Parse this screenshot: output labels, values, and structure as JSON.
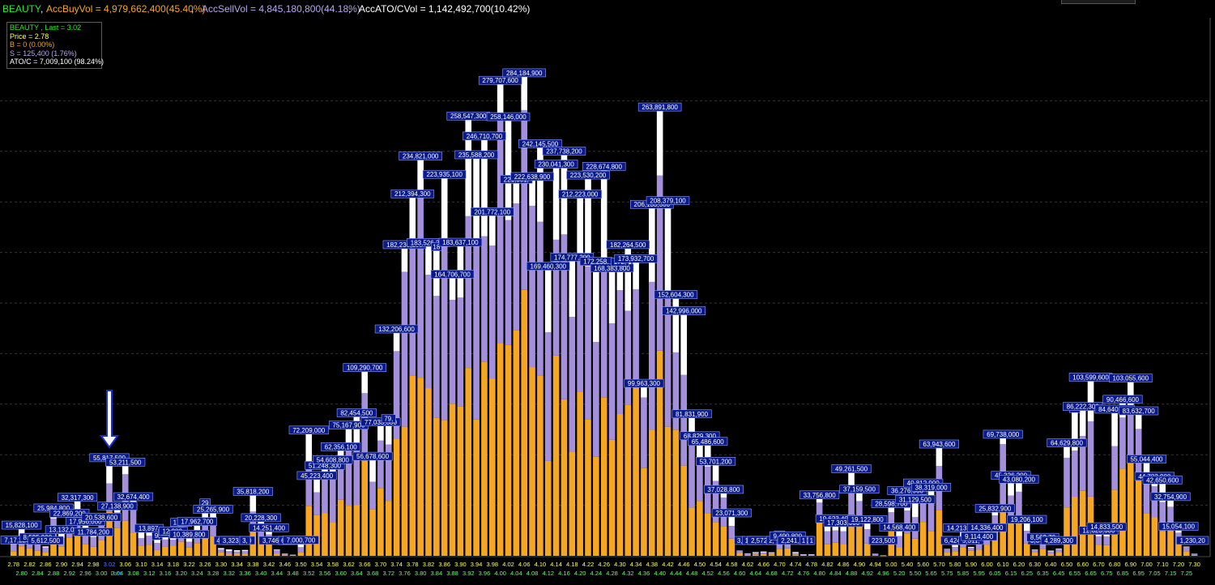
{
  "header": {
    "symbol": "BEAUTY",
    "buy_text": "AccBuyVol = 4,979,662,400(45.40%)",
    "sell_text": "AccSellVol = 4,845,180,800(44.18%)",
    "ato_text": "AccATO/CVol = 1,142,492,700(10.42%)",
    "separator": ","
  },
  "legend": {
    "title": "BEAUTY , Last = 3.02",
    "price": "Price = 2.78",
    "buy": "B = 0 (0.00%)",
    "sell": "S = 125,400 (1.76%)",
    "atoc": "ATO/C = 7,009,100 (98.24%)"
  },
  "colors": {
    "buy": "#f5a623",
    "sell": "#a48fdc",
    "atoc": "#ffffff",
    "label_bg": "#0a1a8c",
    "axis_text": "#ffff66",
    "axis_text_alt": "#66ff66",
    "current_price": "#4a7cff",
    "arrow": "#1f2fd8"
  },
  "chart_data": {
    "type": "bar",
    "stacked": true,
    "x_unit": "price",
    "current_price": 3.02,
    "current_price_label": "Last",
    "series_names": [
      "Buy",
      "Sell",
      "ATO/C"
    ],
    "ylim": [
      0,
      300000000
    ],
    "grid": true,
    "bars": [
      {
        "price": 2.78,
        "total": 7009100,
        "label": "7,17,226"
      },
      {
        "price": 2.8,
        "total": 15828100,
        "label": "15,828,100"
      },
      {
        "price": 2.82,
        "total": 8535000,
        "label": "8,"
      },
      {
        "price": 2.84,
        "total": 8535900,
        "label": "8,535,900"
      },
      {
        "price": 2.86,
        "total": 5612500,
        "label": "5,612,500"
      },
      {
        "price": 2.88,
        "total": 25984800,
        "label": "25,984,800"
      },
      {
        "price": 2.9,
        "total": 13132000,
        "label": "13,132,0"
      },
      {
        "price": 2.92,
        "total": 22869200,
        "label": "22,869,200"
      },
      {
        "price": 2.94,
        "total": 32317300,
        "label": "32,317,300"
      },
      {
        "price": 2.96,
        "total": 17956000,
        "label": "17,956,000"
      },
      {
        "price": 2.98,
        "total": 11784200,
        "label": "11,784,200"
      },
      {
        "price": 3.0,
        "total": 20538600,
        "label": "20,538,600"
      },
      {
        "price": 3.02,
        "total": 55817500,
        "label": "55,817,500"
      },
      {
        "price": 3.04,
        "total": 27138900,
        "label": "27,138,900"
      },
      {
        "price": 3.06,
        "total": 53211500,
        "label": "53,211,500"
      },
      {
        "price": 3.08,
        "total": 32674400,
        "label": "32,674,400"
      },
      {
        "price": 3.1,
        "total": 14000000,
        "label": "14,"
      },
      {
        "price": 3.12,
        "total": 13897000,
        "label": "13,897,"
      },
      {
        "price": 3.14,
        "total": 9500000,
        "label": "9,"
      },
      {
        "price": 3.16,
        "total": 11000000,
        "label": "11,"
      },
      {
        "price": 3.18,
        "total": 12283000,
        "label": "12,283,"
      },
      {
        "price": 3.2,
        "total": 17450000,
        "label": "17,45"
      },
      {
        "price": 3.22,
        "total": 10389800,
        "label": "10,389,800"
      },
      {
        "price": 3.24,
        "total": 17962700,
        "label": "17,962,700"
      },
      {
        "price": 3.26,
        "total": 29000000,
        "label": "29"
      },
      {
        "price": 3.28,
        "total": 25265900,
        "label": "25,265,900"
      },
      {
        "price": 3.3,
        "total": 4600000,
        "label": "4,6"
      },
      {
        "price": 3.32,
        "total": 3800000,
        "label": "3,"
      },
      {
        "price": 3.34,
        "total": 3323100,
        "label": "3,323,100"
      },
      {
        "price": 3.36,
        "total": 3500000,
        "label": "3,"
      },
      {
        "price": 3.38,
        "total": 35818200,
        "label": "35,818,200"
      },
      {
        "price": 3.4,
        "total": 20228300,
        "label": "20,228,300"
      },
      {
        "price": 3.42,
        "total": 14251400,
        "label": "14,251,400"
      },
      {
        "price": 3.44,
        "total": 3746100,
        "label": "3,746,100"
      },
      {
        "price": 3.46,
        "total": 1300000,
        "label": "1,"
      },
      {
        "price": 3.48,
        "total": 640900,
        "label": "640,900"
      },
      {
        "price": 3.5,
        "total": 7000700,
        "label": "7,000,700"
      },
      {
        "price": 3.52,
        "total": 72209000,
        "label": "72,209,000"
      },
      {
        "price": 3.54,
        "total": 45223400,
        "label": "45,223,400"
      },
      {
        "price": 3.56,
        "total": 51248300,
        "label": "51,248,300"
      },
      {
        "price": 3.58,
        "total": 54608800,
        "label": "54,608,800"
      },
      {
        "price": 3.6,
        "total": 62356100,
        "label": "62,356,100"
      },
      {
        "price": 3.62,
        "total": 75167900,
        "label": "75,167,900"
      },
      {
        "price": 3.64,
        "total": 82454500,
        "label": "82,454,500"
      },
      {
        "price": 3.66,
        "total": 109290700,
        "label": "109,290,700"
      },
      {
        "price": 3.68,
        "total": 56678600,
        "label": "56,678,600"
      },
      {
        "price": 3.7,
        "total": 77033800,
        "label": "77,033,800"
      },
      {
        "price": 3.72,
        "total": 79000000,
        "label": "79,"
      },
      {
        "price": 3.74,
        "total": 132206600,
        "label": "132,206,600"
      },
      {
        "price": 3.76,
        "total": 182236200,
        "label": "182,236,200"
      },
      {
        "price": 3.78,
        "total": 212394300,
        "label": "212,394,300"
      },
      {
        "price": 3.8,
        "total": 234821000,
        "label": "234,821,000"
      },
      {
        "price": 3.82,
        "total": 183526200,
        "label": "183,526,200"
      },
      {
        "price": 3.84,
        "total": 181000000,
        "label": "18"
      },
      {
        "price": 3.86,
        "total": 223935100,
        "label": "223,935,100"
      },
      {
        "price": 3.88,
        "total": 164706700,
        "label": "164,706,700"
      },
      {
        "price": 3.9,
        "total": 183637100,
        "label": "183,637,100"
      },
      {
        "price": 3.92,
        "total": 258547300,
        "label": "258,547,300"
      },
      {
        "price": 3.94,
        "total": 235588200,
        "label": "235,588,200"
      },
      {
        "price": 3.96,
        "total": 246710700,
        "label": "246,710,700"
      },
      {
        "price": 3.98,
        "total": 201772100,
        "label": "201,772,100"
      },
      {
        "price": 4.0,
        "total": 279707600,
        "label": "279,707,600"
      },
      {
        "price": 4.02,
        "total": 258146000,
        "label": "258,146,000"
      },
      {
        "price": 4.04,
        "total": 221001000,
        "label": "221,001,"
      },
      {
        "price": 4.06,
        "total": 284184900,
        "label": "284,184,900"
      },
      {
        "price": 4.08,
        "total": 222638900,
        "label": "222,638,900"
      },
      {
        "price": 4.1,
        "total": 242145500,
        "label": "242,145,500"
      },
      {
        "price": 4.12,
        "total": 169460300,
        "label": "169,460,300"
      },
      {
        "price": 4.14,
        "total": 230041300,
        "label": "230,041,300"
      },
      {
        "price": 4.16,
        "total": 237738200,
        "label": "237,738,200"
      },
      {
        "price": 4.18,
        "total": 174777200,
        "label": "174,777,200"
      },
      {
        "price": 4.2,
        "total": 212223000,
        "label": "212,223,000"
      },
      {
        "price": 4.22,
        "total": 223530200,
        "label": "223,530,200"
      },
      {
        "price": 4.24,
        "total": 172258000,
        "label": "172,258,"
      },
      {
        "price": 4.26,
        "total": 228674800,
        "label": "228,674,800"
      },
      {
        "price": 4.28,
        "total": 168383800,
        "label": "168,383,800"
      },
      {
        "price": 4.3,
        "total": 172000000,
        "label": "172,"
      },
      {
        "price": 4.32,
        "total": 182264500,
        "label": "182,264,500"
      },
      {
        "price": 4.34,
        "total": 173932700,
        "label": "173,932,700"
      },
      {
        "price": 4.36,
        "total": 99963300,
        "label": "99,963,300"
      },
      {
        "price": 4.38,
        "total": 206133300,
        "label": "206,133,300"
      },
      {
        "price": 4.4,
        "total": 263891800,
        "label": "263,891,800"
      },
      {
        "price": 4.42,
        "total": 208379100,
        "label": "208,379,100"
      },
      {
        "price": 4.44,
        "total": 152604300,
        "label": "152,604,300"
      },
      {
        "price": 4.46,
        "total": 142996000,
        "label": "142,996,000"
      },
      {
        "price": 4.48,
        "total": 81831900,
        "label": "81,831,900"
      },
      {
        "price": 4.5,
        "total": 68829300,
        "label": "68,829,300"
      },
      {
        "price": 4.52,
        "total": 65486600,
        "label": "65,486,600"
      },
      {
        "price": 4.54,
        "total": 53701200,
        "label": "53,701,200"
      },
      {
        "price": 4.56,
        "total": 37028800,
        "label": "37,028,800"
      },
      {
        "price": 4.58,
        "total": 23071300,
        "label": "23,071,300"
      },
      {
        "price": 4.6,
        "total": 3100000,
        "label": "3,"
      },
      {
        "price": 4.62,
        "total": 1500000,
        "label": "1,"
      },
      {
        "price": 4.64,
        "total": 2200000,
        "label": "2,2"
      },
      {
        "price": 4.66,
        "total": 2572700,
        "label": "2,572,70"
      },
      {
        "price": 4.68,
        "total": 2100000,
        "label": "2,"
      },
      {
        "price": 4.7,
        "total": 10000000,
        "label": "10"
      },
      {
        "price": 4.72,
        "total": 9490800,
        "label": "9,490,800"
      },
      {
        "price": 4.74,
        "total": 2241100,
        "label": "2,241,100"
      },
      {
        "price": 4.76,
        "total": 1000000,
        "label": "1"
      },
      {
        "price": 4.78,
        "total": 1000000,
        "label": "1"
      },
      {
        "price": 4.8,
        "total": 33756800,
        "label": "33,756,800"
      },
      {
        "price": 4.82,
        "total": 19600000,
        "label": "19"
      },
      {
        "price": 4.84,
        "total": 19623400,
        "label": "19,623,400"
      },
      {
        "price": 4.86,
        "total": 17303000,
        "label": "17,303,000"
      },
      {
        "price": 4.88,
        "total": 49261500,
        "label": "49,261,500"
      },
      {
        "price": 4.9,
        "total": 37159500,
        "label": "37,159,500"
      },
      {
        "price": 4.92,
        "total": 19122800,
        "label": "19,122,800"
      },
      {
        "price": 4.94,
        "total": 1200000,
        "label": "1,2"
      },
      {
        "price": 4.96,
        "total": 223500,
        "label": "223,500"
      },
      {
        "price": 5.0,
        "total": 28598700,
        "label": "28,598,700"
      },
      {
        "price": 5.2,
        "total": 14568400,
        "label": "14,568,400"
      },
      {
        "price": 5.4,
        "total": 36276900,
        "label": "36,276,900"
      },
      {
        "price": 5.5,
        "total": 31129500,
        "label": "31,129,500"
      },
      {
        "price": 5.6,
        "total": 40812900,
        "label": "40,812,900"
      },
      {
        "price": 5.65,
        "total": 38319000,
        "label": "38,319,000"
      },
      {
        "price": 5.7,
        "total": 63943600,
        "label": "63,943,600"
      },
      {
        "price": 5.75,
        "total": 4100000,
        "label": "4,"
      },
      {
        "price": 5.8,
        "total": 6424900,
        "label": "6,424,9"
      },
      {
        "price": 5.85,
        "total": 14213300,
        "label": "14,213,300"
      },
      {
        "price": 5.9,
        "total": 5311000,
        "label": "5,311,"
      },
      {
        "price": 5.95,
        "total": 9114400,
        "label": "9,114,400"
      },
      {
        "price": 6.0,
        "total": 14336400,
        "label": "14,336,400"
      },
      {
        "price": 6.05,
        "total": 25832900,
        "label": "25,832,900"
      },
      {
        "price": 6.1,
        "total": 69738000,
        "label": "69,738,000"
      },
      {
        "price": 6.15,
        "total": 45326200,
        "label": "45,326,200"
      },
      {
        "price": 6.2,
        "total": 43080200,
        "label": "43,080,200"
      },
      {
        "price": 6.25,
        "total": 19206100,
        "label": "19,206,100"
      },
      {
        "price": 6.3,
        "total": 3800000,
        "label": "3,8"
      },
      {
        "price": 6.35,
        "total": 8562700,
        "label": "8,562,70"
      },
      {
        "price": 6.4,
        "total": 3100000,
        "label": "3,1"
      },
      {
        "price": 6.45,
        "total": 4289300,
        "label": "4,289,300"
      },
      {
        "price": 6.5,
        "total": 64629800,
        "label": "64,629,800"
      },
      {
        "price": 6.55,
        "total": 85000000,
        "label": "85"
      },
      {
        "price": 6.6,
        "total": 86222300,
        "label": "86,222,300"
      },
      {
        "price": 6.65,
        "total": 103599600,
        "label": "103,599,600"
      },
      {
        "price": 6.7,
        "total": 12623600,
        "label": "12,623,600"
      },
      {
        "price": 6.75,
        "total": 14833500,
        "label": "14,833,500"
      },
      {
        "price": 6.8,
        "total": 84640100,
        "label": "84,640,100"
      },
      {
        "price": 6.85,
        "total": 90466600,
        "label": "90,466,600"
      },
      {
        "price": 6.9,
        "total": 103055600,
        "label": "103,055,600"
      },
      {
        "price": 6.95,
        "total": 83632700,
        "label": "83,632,700"
      },
      {
        "price": 7.0,
        "total": 55044400,
        "label": "55,044,400"
      },
      {
        "price": 7.05,
        "total": 44782900,
        "label": "44,782,900"
      },
      {
        "price": 7.1,
        "total": 42650600,
        "label": "42,650,600"
      },
      {
        "price": 7.15,
        "total": 32754900,
        "label": "32,754,900"
      },
      {
        "price": 7.2,
        "total": 15054100,
        "label": "15,054,100"
      },
      {
        "price": 7.25,
        "total": 5500000,
        "label": "5,5"
      },
      {
        "price": 7.3,
        "total": 1230200,
        "label": "1,230,20"
      }
    ],
    "x_tick_labels": [
      "2.78",
      "2.80",
      "2.82",
      "2.84",
      "2.86",
      "2.88",
      "2.90",
      "2.92",
      "2.94",
      "2.96",
      "2.98",
      "3.00",
      "3.02",
      "3.04",
      "3.06",
      "3.08",
      "3.10",
      "3.12",
      "3.14",
      "3.16",
      "3.18",
      "3.20",
      "3.22",
      "3.24",
      "3.26",
      "3.28",
      "3.30",
      "3.32",
      "3.34",
      "3.36",
      "3.38",
      "3.40",
      "3.42",
      "3.44",
      "3.46",
      "3.48",
      "3.50",
      "3.52",
      "3.54",
      "3.56",
      "3.58",
      "3.60",
      "3.62",
      "3.64",
      "3.66",
      "3.68",
      "3.70",
      "3.72",
      "3.74",
      "3.76",
      "3.78",
      "3.80",
      "3.82",
      "3.84",
      "3.86",
      "3.88",
      "3.90",
      "3.92",
      "3.94",
      "3.96",
      "3.98",
      "4.00",
      "4.02",
      "4.04",
      "4.06",
      "4.08",
      "4.10",
      "4.12",
      "4.14",
      "4.16",
      "4.18",
      "4.20",
      "4.22",
      "4.24",
      "4.26",
      "4.28",
      "4.30",
      "4.32",
      "4.34",
      "4.36",
      "4.38",
      "4.40",
      "4.42",
      "4.44",
      "4.46",
      "4.48",
      "4.50",
      "4.52",
      "4.54",
      "4.56",
      "4.58",
      "4.60",
      "4.62",
      "4.64",
      "4.66",
      "4.68",
      "4.70",
      "4.72",
      "4.74",
      "4.76",
      "4.78",
      "4.80",
      "4.82",
      "4.84",
      "4.86",
      "4.88",
      "4.90",
      "4.92",
      "4.94",
      "4.96",
      "5.00",
      "5.20",
      "5.40",
      "5.50",
      "5.60",
      "5.65",
      "5.70",
      "5.75",
      "5.80",
      "5.85",
      "5.90",
      "5.95",
      "6.00",
      "6.05",
      "6.10",
      "6.15",
      "6.20",
      "6.25",
      "6.30",
      "6.35",
      "6.40",
      "6.45",
      "6.50",
      "6.55",
      "6.60",
      "6.65",
      "6.70",
      "6.75",
      "6.80",
      "6.85",
      "6.90",
      "6.95",
      "7.00",
      "7.05",
      "7.10",
      "7.15",
      "7.20",
      "7.25",
      "7.30"
    ]
  }
}
